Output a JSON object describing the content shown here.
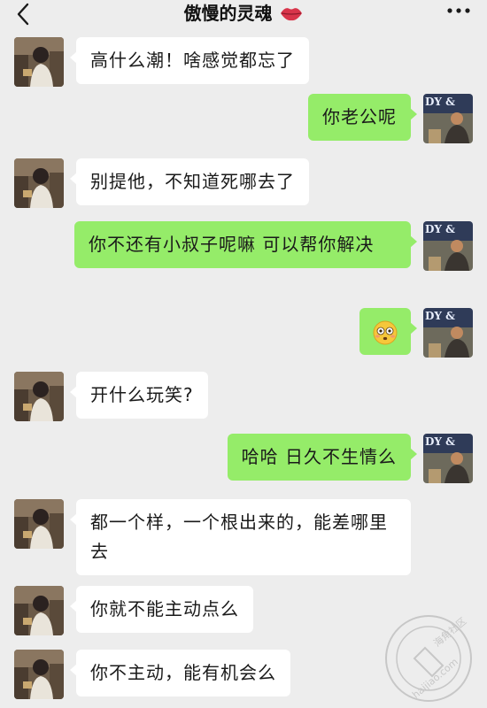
{
  "header": {
    "title": "傲慢的灵魂",
    "back_icon": "chevron-left-icon",
    "more_icon": "more-dots-icon",
    "title_emoji": "lips-icon"
  },
  "messages": [
    {
      "side": "left",
      "text": "高什么潮！啥感觉都忘了"
    },
    {
      "side": "right",
      "text": "你老公呢"
    },
    {
      "side": "left",
      "text": "别提他，不知道死哪去了"
    },
    {
      "side": "right",
      "text": "你不还有小叔子呢嘛  可以帮你解决"
    },
    {
      "side": "right",
      "text": "",
      "emoji": "flushed-face-icon"
    },
    {
      "side": "left",
      "text": "开什么玩笑?"
    },
    {
      "side": "right",
      "text": "哈哈 日久不生情么"
    },
    {
      "side": "left",
      "text": "都一个样，一个根出来的，能差哪里去"
    },
    {
      "side": "left",
      "text": "你就不能主动点么"
    },
    {
      "side": "left",
      "text": "你不主动，能有机会么"
    }
  ],
  "avatar_badge_text": "DY &",
  "watermark": {
    "line1": "海角社区",
    "line2": "haijiao.com"
  },
  "colors": {
    "background": "#ededed",
    "left_bubble": "#ffffff",
    "right_bubble": "#95ec69"
  }
}
